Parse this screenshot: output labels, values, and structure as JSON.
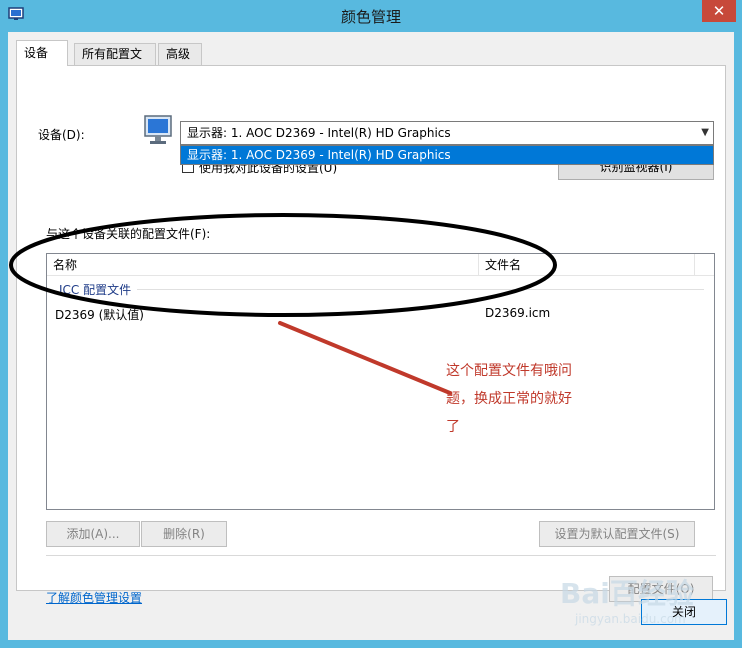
{
  "window": {
    "title": "颜色管理",
    "close_glyph": "✕"
  },
  "tabs": [
    {
      "label": "设备",
      "active": true
    },
    {
      "label": "所有配置文件",
      "active": false
    },
    {
      "label": "高级",
      "active": false
    }
  ],
  "device": {
    "label": "设备(D):",
    "selected": "显示器: 1. AOC D2369 - Intel(R) HD Graphics",
    "dropdown_option": "显示器: 1. AOC D2369 - Intel(R) HD Graphics",
    "use_settings_label": "使用我对此设备的设置(U)",
    "identify_button": "识别监视器(I)"
  },
  "profiles": {
    "section_label": "与这个设备关联的配置文件(F):",
    "columns": [
      "名称",
      "文件名"
    ],
    "group_label": "ICC 配置文件",
    "rows": [
      {
        "name": "D2369 (默认值)",
        "file": "D2369.icm"
      }
    ]
  },
  "buttons": {
    "add": "添加(A)...",
    "remove": "删除(R)",
    "set_default": "设置为默认配置文件(S)",
    "profile": "配置文件(O)",
    "close": "关闭"
  },
  "link": {
    "learn_more": "了解颜色管理设置"
  },
  "annotation": {
    "line1": "这个配置文件有哦问",
    "line2": "题，换成正常的就好",
    "line3": "了"
  },
  "watermark": {
    "main": "Bai百经验",
    "sub": "jingyan.baidu.com"
  },
  "icons": [
    "monitor-icon",
    "chevron-down-icon",
    "app-icon",
    "close-icon"
  ],
  "colors": {
    "titlebar": "#58b9df",
    "close_button": "#c7493a",
    "selection": "#0078d7",
    "annotation": "#c0392b",
    "link": "#0066cc"
  }
}
